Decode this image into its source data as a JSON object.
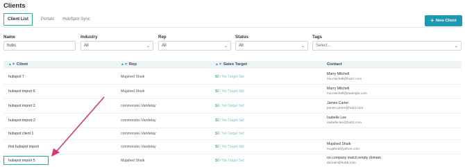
{
  "page": {
    "title": "Clients"
  },
  "tabs": [
    {
      "label": "Client List",
      "active": true
    },
    {
      "label": "Portals",
      "active": false
    },
    {
      "label": "HubSpot Sync",
      "active": false
    }
  ],
  "new_client_button": {
    "label": "New Client"
  },
  "filters": {
    "name": {
      "label": "Name",
      "value": "hubs"
    },
    "industry": {
      "label": "Industry",
      "value": "All"
    },
    "rep": {
      "label": "Rep",
      "value": "All"
    },
    "status": {
      "label": "Status",
      "value": "All"
    },
    "tags": {
      "label": "Tags",
      "placeholder": "Select..."
    }
  },
  "table": {
    "headers": {
      "client": "Client",
      "rep": "Rep",
      "sales_target": "Sales Target",
      "contact": "Contact"
    },
    "rows": [
      {
        "client": "hubspot 7",
        "rep": "Mujahed Shaik",
        "target_value": "$0",
        "target_note": "/ No Target Set",
        "contact_name": "Marry Mitchell",
        "contact_email": "ma.mitchell@hub7.com"
      },
      {
        "client": "hubspot import 6",
        "rep": "Mujahed Shaik",
        "target_value": "$0",
        "target_note": "/ No Target Set",
        "contact_name": "Marry Mitchell",
        "contact_email": "ma.mitchell@example.com"
      },
      {
        "client": "hubspot import 3",
        "rep": "commonsku Vandelay",
        "target_value": "$0",
        "target_note": "/ No Target Set",
        "contact_name": "James Carter",
        "contact_email": "james.carter@hub3.com"
      },
      {
        "client": "hubspot import-2",
        "rep": "commonsku Vandelay",
        "target_value": "$0",
        "target_note": "/ No Target Set",
        "contact_name": "Isabelle Lee",
        "contact_email": "isabelle.lee@hub2.com"
      },
      {
        "client": "hubspot client 1",
        "rep": "commonsku Vandelay",
        "target_value": "$0",
        "target_note": "/ No Target Set",
        "contact_name": "",
        "contact_email": ""
      },
      {
        "client": "first hubspot import",
        "rep": "commonsku Vandelay",
        "target_value": "$0",
        "target_note": "/ No Target Set",
        "contact_name": "Mujahed Shaik",
        "contact_email": "mujahed@yahoo.com"
      },
      {
        "client": "hubspot import 5",
        "rep": "Mujahed Shaik",
        "target_value": "$0",
        "target_note": "/ No Target Set",
        "contact_name": "no company match empty domain",
        "contact_email": "domain@hub5.com"
      }
    ]
  },
  "colors": {
    "accent": "#1d9ab2",
    "highlight": "#23b39a",
    "arrow": "#d9357a"
  }
}
